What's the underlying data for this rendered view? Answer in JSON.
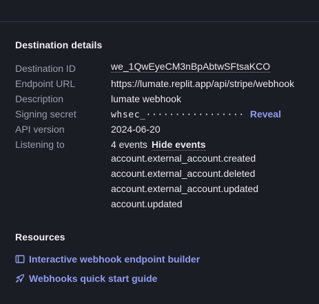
{
  "destination": {
    "title": "Destination details",
    "fields": {
      "destination_id": {
        "label": "Destination ID",
        "value": "we_1QwEyeCM3nBpAbtwSFtsaKCO"
      },
      "endpoint_url": {
        "label": "Endpoint URL",
        "value": "https://lumate.replit.app/api/stripe/webhook"
      },
      "description": {
        "label": "Description",
        "value": "lumate webhook"
      },
      "signing_secret": {
        "label": "Signing secret",
        "value": "whsec_·················",
        "reveal_label": "Reveal"
      },
      "api_version": {
        "label": "API version",
        "value": "2024-06-20"
      },
      "listening_to": {
        "label": "Listening to",
        "value": "4 events",
        "hide_label": "Hide events"
      }
    },
    "events": [
      "account.external_account.created",
      "account.external_account.deleted",
      "account.external_account.updated",
      "account.updated"
    ]
  },
  "resources": {
    "title": "Resources",
    "links": [
      {
        "label": "Interactive webhook endpoint builder",
        "icon": "book-icon"
      },
      {
        "label": "Webhooks quick start guide",
        "icon": "rocket-icon"
      }
    ]
  },
  "colors": {
    "background": "#1b1d24",
    "label": "#9a9eaa",
    "text": "#e6e8ee",
    "link": "#8e9cf0",
    "divider": "#30333d"
  }
}
